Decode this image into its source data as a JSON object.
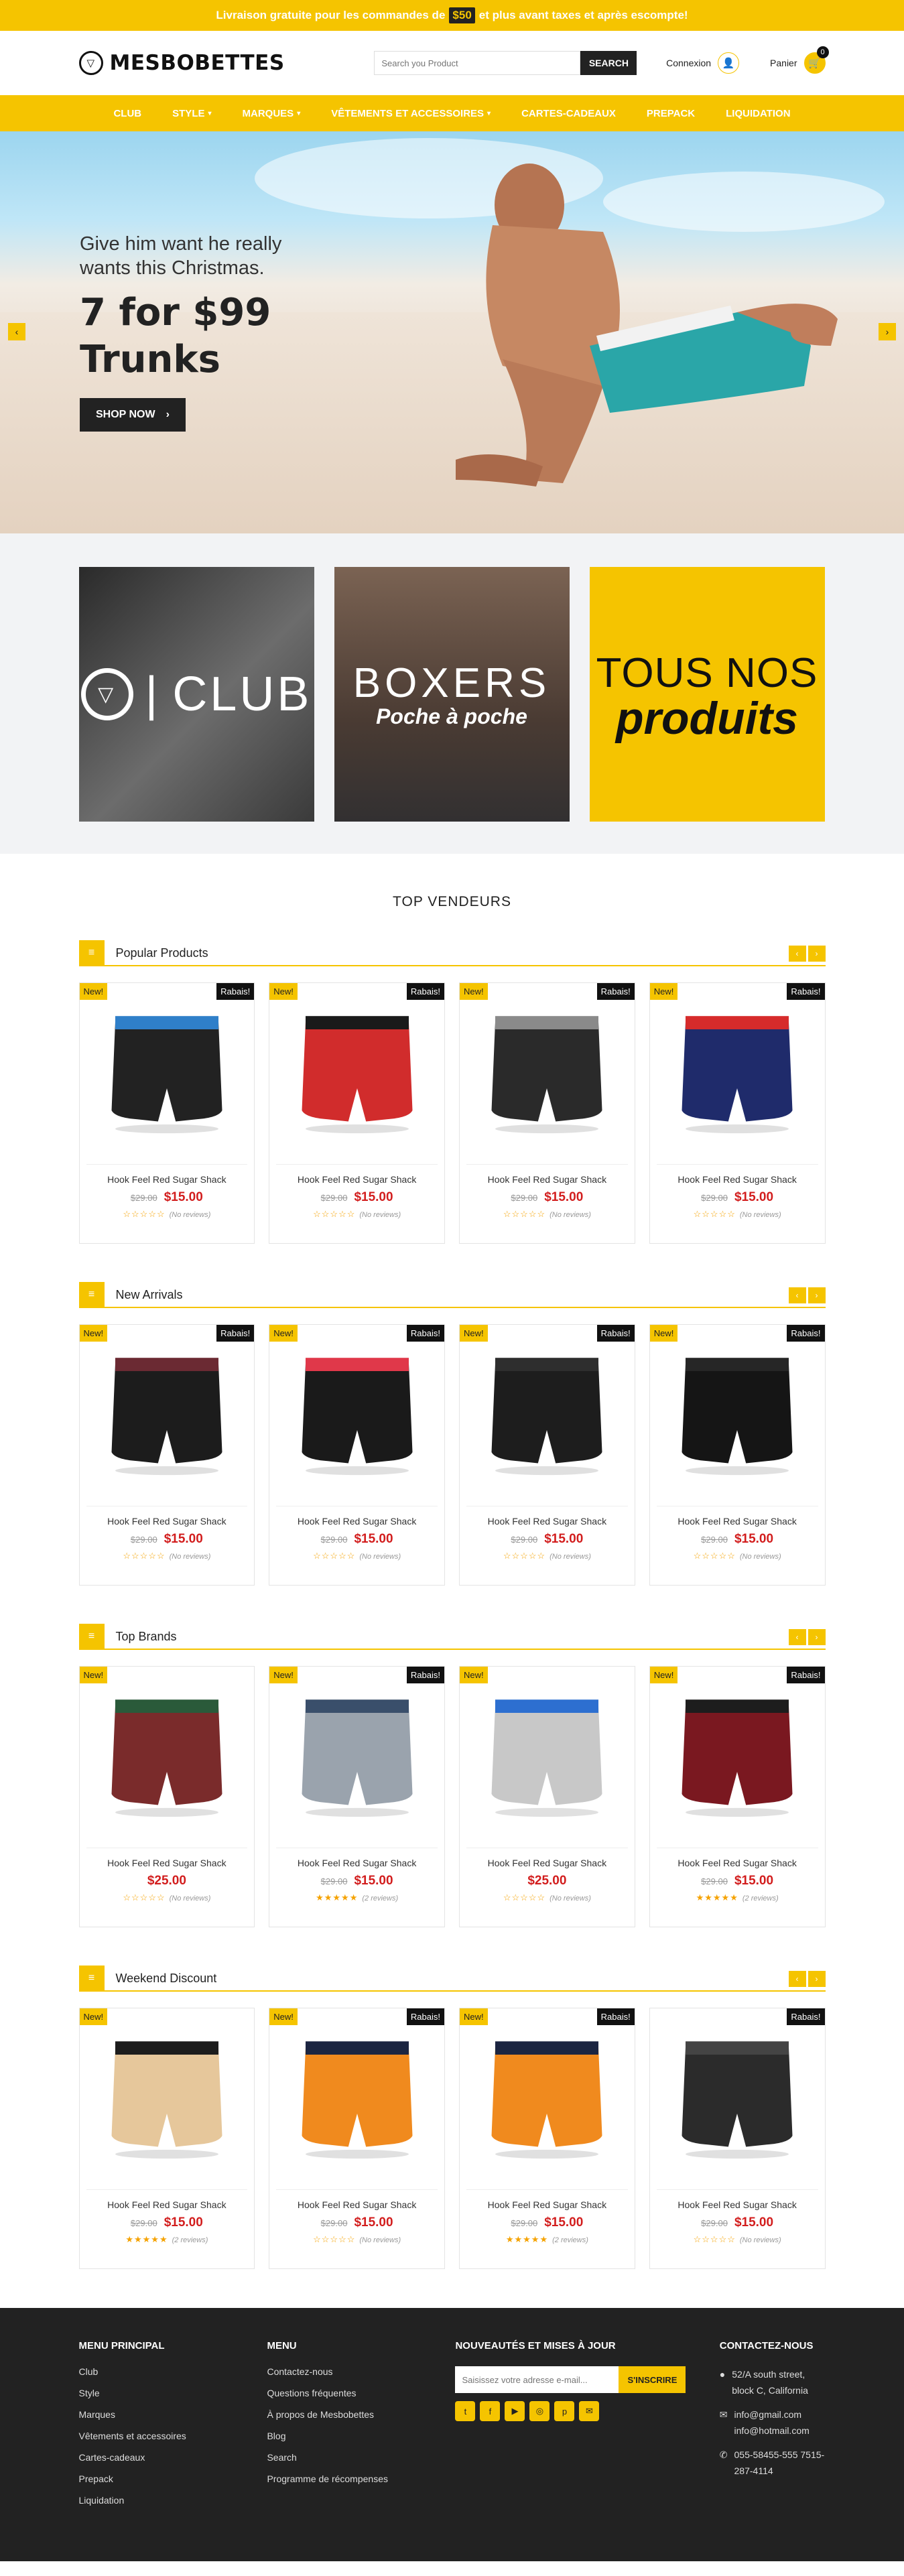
{
  "topbar": {
    "before": "Livraison gratuite pour les commandes de",
    "amount": "$50",
    "after": "et plus avant taxes et après escompte!"
  },
  "header": {
    "logo": "MESBOBETTES",
    "search_placeholder": "Search you Product",
    "search_button": "SEARCH",
    "login_label": "Connexion",
    "cart_label": "Panier",
    "cart_count": "0"
  },
  "nav": [
    {
      "label": "CLUB"
    },
    {
      "label": "STYLE",
      "chev": "▾"
    },
    {
      "label": "MARQUES",
      "chev": "▾"
    },
    {
      "label": "VÊTEMENTS ET ACCESSOIRES",
      "chev": "▾"
    },
    {
      "label": "CARTES-CADEAUX"
    },
    {
      "label": "PREPACK"
    },
    {
      "label": "LIQUIDATION"
    }
  ],
  "hero": {
    "line1": "Give him want he really",
    "line2": "wants this Christmas.",
    "headline1": "7 for $99",
    "headline2": "Trunks",
    "button": "SHOP NOW"
  },
  "banners": {
    "club": "CLUB",
    "boxers": "BOXERS",
    "boxers_sub": "Poche à poche",
    "tous": "TOUS NOS",
    "produits": "produits"
  },
  "section_title": "TOP VENDEURS",
  "blocks": [
    {
      "title": "Popular Products",
      "products": [
        {
          "new": "New!",
          "sale": "Rabais!",
          "name": "Hook Feel Red Sugar Shack",
          "old": "$29.00",
          "price": "$15.00",
          "stars": "☆☆☆☆☆",
          "reviews": "(No reviews)",
          "colors": [
            "#222222",
            "#2f7fc9"
          ]
        },
        {
          "new": "New!",
          "sale": "Rabais!",
          "name": "Hook Feel Red Sugar Shack",
          "old": "$29.00",
          "price": "$15.00",
          "stars": "☆☆☆☆☆",
          "reviews": "(No reviews)",
          "colors": [
            "#d12c2c",
            "#1a1a1a"
          ]
        },
        {
          "new": "New!",
          "sale": "Rabais!",
          "name": "Hook Feel Red Sugar Shack",
          "old": "$29.00",
          "price": "$15.00",
          "stars": "☆☆☆☆☆",
          "reviews": "(No reviews)",
          "colors": [
            "#2a2a2a",
            "#8a8a8a"
          ]
        },
        {
          "new": "New!",
          "sale": "Rabais!",
          "name": "Hook Feel Red Sugar Shack",
          "old": "$29.00",
          "price": "$15.00",
          "stars": "☆☆☆☆☆",
          "reviews": "(No reviews)",
          "colors": [
            "#1f2b6b",
            "#d62b2b"
          ]
        }
      ]
    },
    {
      "title": "New Arrivals",
      "products": [
        {
          "new": "New!",
          "sale": "Rabais!",
          "name": "Hook Feel Red Sugar Shack",
          "old": "$29.00",
          "price": "$15.00",
          "stars": "☆☆☆☆☆",
          "reviews": "(No reviews)",
          "colors": [
            "#1c1c1c",
            "#6b2a33"
          ]
        },
        {
          "new": "New!",
          "sale": "Rabais!",
          "name": "Hook Feel Red Sugar Shack",
          "old": "$29.00",
          "price": "$15.00",
          "stars": "☆☆☆☆☆",
          "reviews": "(No reviews)",
          "colors": [
            "#1a1a1a",
            "#e0384a"
          ]
        },
        {
          "new": "New!",
          "sale": "Rabais!",
          "name": "Hook Feel Red Sugar Shack",
          "old": "$29.00",
          "price": "$15.00",
          "stars": "☆☆☆☆☆",
          "reviews": "(No reviews)",
          "colors": [
            "#1d1d1d",
            "#2e2e2e"
          ]
        },
        {
          "new": "New!",
          "sale": "Rabais!",
          "name": "Hook Feel Red Sugar Shack",
          "old": "$29.00",
          "price": "$15.00",
          "stars": "☆☆☆☆☆",
          "reviews": "(No reviews)",
          "colors": [
            "#151515",
            "#262626"
          ]
        }
      ]
    },
    {
      "title": "Top Brands",
      "products": [
        {
          "new": "New!",
          "sale": "",
          "name": "Hook Feel Red Sugar Shack",
          "old": "",
          "price": "$25.00",
          "stars": "☆☆☆☆☆",
          "reviews": "(No reviews)",
          "colors": [
            "#7a2b2b",
            "#2a5a3a"
          ]
        },
        {
          "new": "New!",
          "sale": "Rabais!",
          "name": "Hook Feel Red Sugar Shack",
          "old": "$29.00",
          "price": "$15.00",
          "stars": "★★★★★",
          "reviews": "(2 reviews)",
          "colors": [
            "#9aa3ad",
            "#3a4f6b"
          ]
        },
        {
          "new": "New!",
          "sale": "",
          "name": "Hook Feel Red Sugar Shack",
          "old": "",
          "price": "$25.00",
          "stars": "☆☆☆☆☆",
          "reviews": "(No reviews)",
          "colors": [
            "#c8c8c8",
            "#2d6fd0"
          ]
        },
        {
          "new": "New!",
          "sale": "Rabais!",
          "name": "Hook Feel Red Sugar Shack",
          "old": "$29.00",
          "price": "$15.00",
          "stars": "★★★★★",
          "reviews": "(2 reviews)",
          "colors": [
            "#7a1820",
            "#1d1d1d"
          ]
        }
      ]
    },
    {
      "title": "Weekend Discount",
      "products": [
        {
          "new": "New!",
          "sale": "",
          "name": "Hook Feel Red Sugar Shack",
          "old": "$29.00",
          "price": "$15.00",
          "stars": "★★★★★",
          "reviews": "(2 reviews)",
          "colors": [
            "#e6c79b",
            "#1c1c1c"
          ]
        },
        {
          "new": "New!",
          "sale": "Rabais!",
          "name": "Hook Feel Red Sugar Shack",
          "old": "$29.00",
          "price": "$15.00",
          "stars": "☆☆☆☆☆",
          "reviews": "(No reviews)",
          "colors": [
            "#f08a1e",
            "#1b2541"
          ]
        },
        {
          "new": "New!",
          "sale": "Rabais!",
          "name": "Hook Feel Red Sugar Shack",
          "old": "$29.00",
          "price": "$15.00",
          "stars": "★★★★★",
          "reviews": "(2 reviews)",
          "colors": [
            "#f08a1e",
            "#1b2541"
          ]
        },
        {
          "new": "",
          "sale": "Rabais!",
          "name": "Hook Feel Red Sugar Shack",
          "old": "$29.00",
          "price": "$15.00",
          "stars": "☆☆☆☆☆",
          "reviews": "(No reviews)",
          "colors": [
            "#2b2b2b",
            "#444444"
          ]
        }
      ]
    }
  ],
  "footer": {
    "col1_title": "MENU PRINCIPAL",
    "col1": [
      "Club",
      "Style",
      "Marques",
      "Vêtements et accessoires",
      "Cartes-cadeaux",
      "Prepack",
      "Liquidation"
    ],
    "col2_title": "MENU",
    "col2": [
      "Contactez-nous",
      "Questions fréquentes",
      "À propos de Mesbobettes",
      "Blog",
      "Search",
      "Programme de récompenses"
    ],
    "col3_title": "NOUVEAUTÉS ET MISES À JOUR",
    "newsletter_placeholder": "Saisissez votre adresse e-mail...",
    "newsletter_button": "S'INSCRIRE",
    "col4_title": "CONTACTEZ-NOUS",
    "address": "52/A south street, block C, California",
    "emails": "info@gmail.com info@hotmail.com",
    "phones": "055-58455-555 7515-287-4114"
  },
  "colors": {
    "accent": "#f5c400",
    "dark": "#222222",
    "sale": "#d21d1d"
  }
}
